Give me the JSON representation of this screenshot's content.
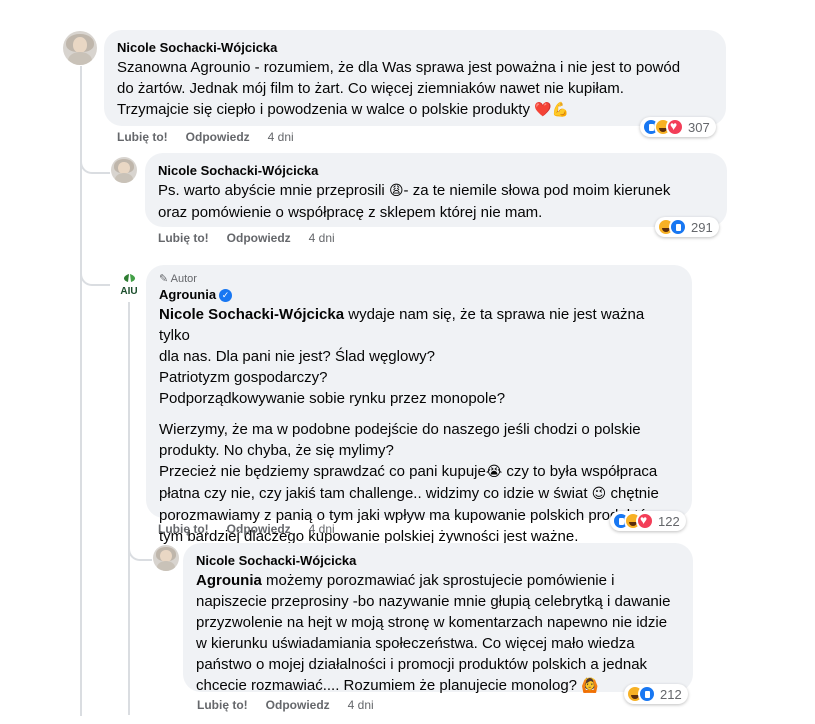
{
  "comment1": {
    "author": "Nicole Sochacki-Wójcicka",
    "lines": [
      "Szanowna Agrounio - rozumiem, że dla Was sprawa jest poważna i nie jest to powód",
      "do żartów. Jednak mój film to żart. Co więcej ziemniaków nawet nie kupiłam.",
      "Trzymajcie się ciepło i powodzenia w walce o polskie produkty"
    ],
    "emojis": "❤️💪",
    "like": "Lubię to!",
    "reply": "Odpowiedz",
    "time": "4 dni",
    "reaction_count": "307"
  },
  "comment2": {
    "author": "Nicole Sochacki-Wójcicka",
    "line1_start": "Ps. warto abyście mnie przeprosili",
    "emoji1": "😩",
    "line1_end": "- za te niemile słowa pod moim kierunek",
    "line2": "oraz pomówienie o współpracę z sklepem której nie mam.",
    "like": "Lubię to!",
    "reply": "Odpowiedz",
    "time": "4 dni",
    "reaction_count": "291"
  },
  "comment3": {
    "badge": "Autor",
    "author": "Agrounia",
    "logo_text": "AIU",
    "mention": "Nicole Sochacki-Wójcicka",
    "p1_l1": " wydaje nam się, że ta sprawa nie jest ważna tylko",
    "p1_l2": "dla nas. Dla pani nie jest? Ślad węglowy?",
    "p1_l3": "Patriotyzm gospodarczy?",
    "p1_l4": "Podporządkowywanie sobie rynku przez monopole?",
    "p2_l1": "Wierzymy, że ma w podobne podejście do naszego jeśli chodzi o polskie",
    "p2_l2": "produkty. No chyba, że się mylimy?",
    "p2_l3a": "Przecież nie będziemy sprawdzać co pani kupuje",
    "emoji_a": "😭",
    "p2_l3b": " czy to była współpraca",
    "p2_l4a": "płatna czy nie, czy jakiś tam challenge.. widzimy co idzie w świat",
    "emoji_b": "😉",
    "p2_l4b": " chętnie",
    "p2_l5": "porozmawiamy z panią o tym jaki wpływ ma kupowanie polskich produktów, a",
    "p2_l6": "tym bardziej dlaczego kupowanie polskiej żywności jest ważne.",
    "like": "Lubię to!",
    "reply": "Odpowiedz",
    "time": "4 dni",
    "reaction_count": "122"
  },
  "comment4": {
    "author": "Nicole Sochacki-Wójcicka",
    "mention": "Agrounia",
    "l1": " możemy porozmawiać jak sprostujecie pomówienie i",
    "l2": "napiszecie przeprosiny -bo nazywanie mnie głupią celebrytką i dawanie",
    "l3": "przyzwolenie na hejt w moją stronę w komentarzach napewno nie idzie",
    "l4": "w kierunku uświadamiania społeczeństwa. Co więcej mało wiedza",
    "l5": "państwo o mojej działalności i promocji produktów polskich a jednak",
    "l6": "chcecie rozmawiać.... Rozumiem że planujecie monolog?",
    "emoji": "🙆",
    "like": "Lubię to!",
    "reply": "Odpowiedz",
    "time": "4 dni",
    "reaction_count": "212"
  },
  "colors": {
    "bubble": "#f0f2f5",
    "secondary_text": "#65676b",
    "like_blue": "#1877f2",
    "heart_red": "#f33e58",
    "haha_yellow": "#f7b125"
  }
}
